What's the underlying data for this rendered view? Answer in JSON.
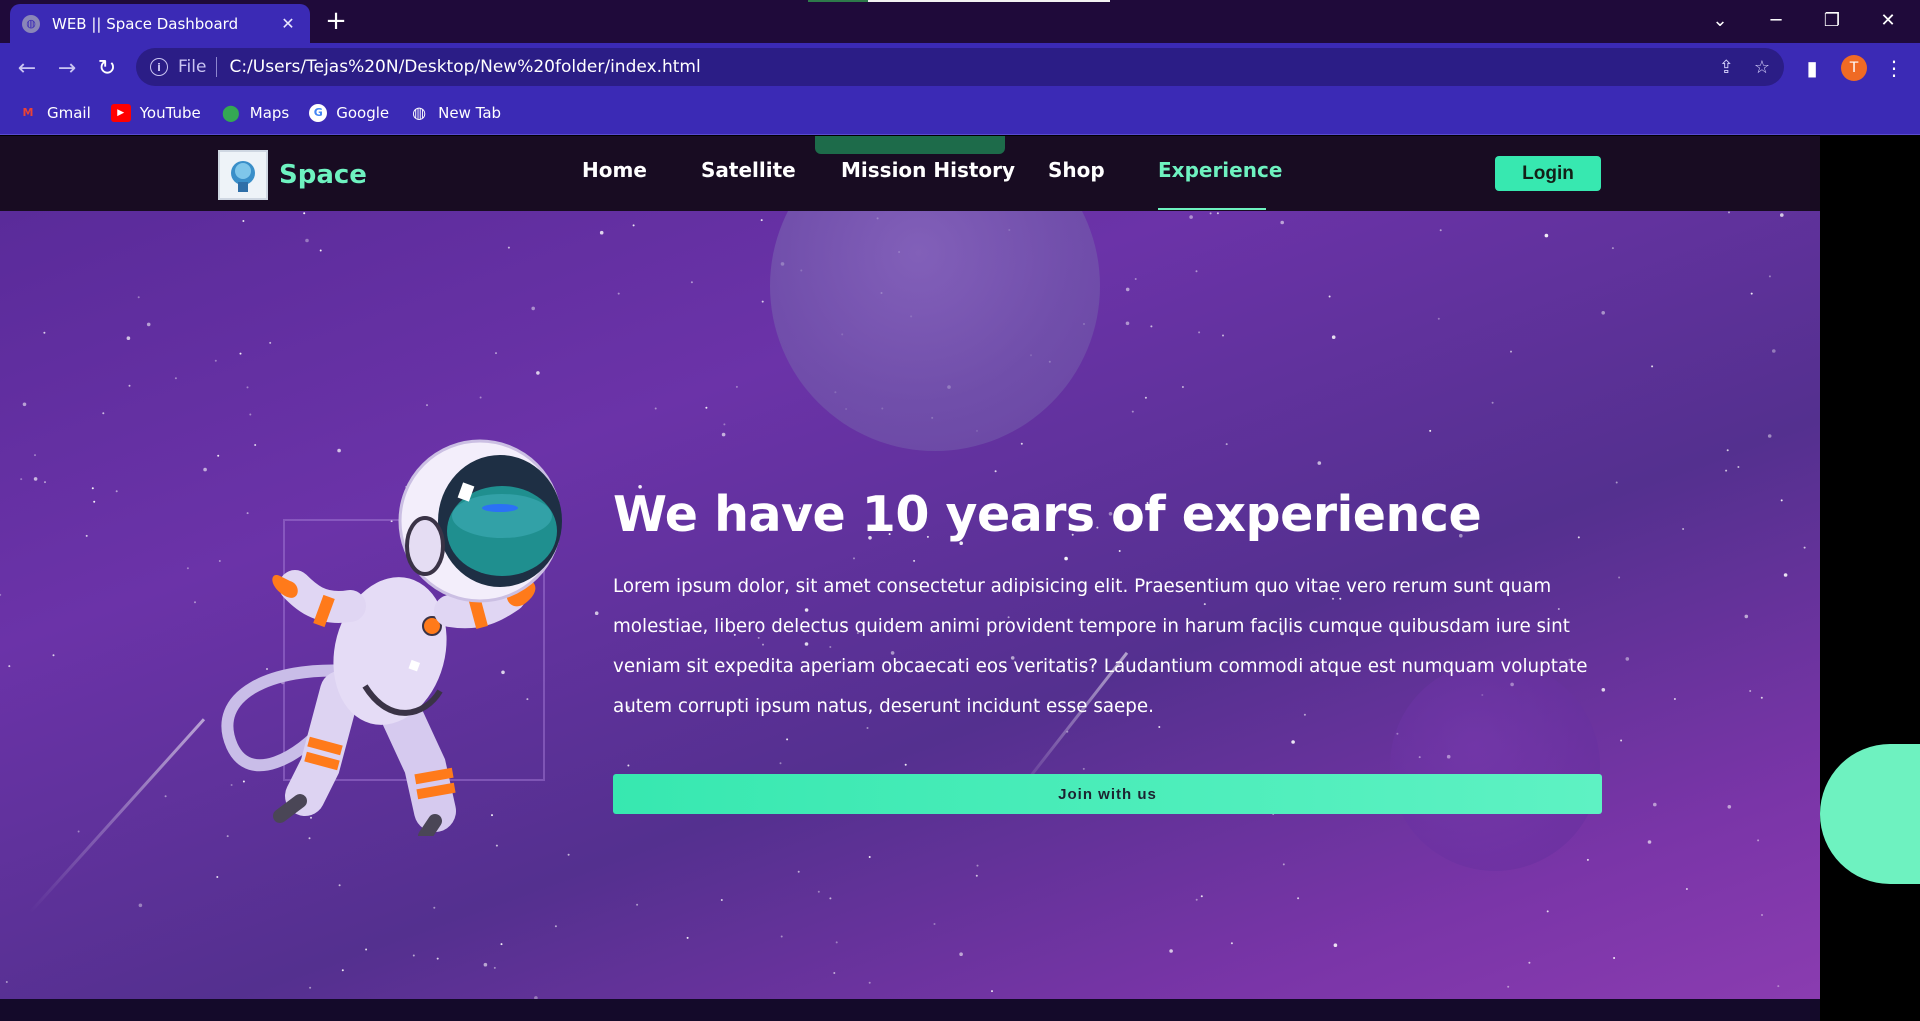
{
  "browser": {
    "tab_title": "WEB || Space Dashboard",
    "address_scheme": "File",
    "address_url": "C:/Users/Tejas%20N/Desktop/New%20folder/index.html",
    "profile_initial": "T",
    "bookmarks": [
      {
        "label": "Gmail",
        "icon": "gmail-icon"
      },
      {
        "label": "YouTube",
        "icon": "youtube-icon"
      },
      {
        "label": "Maps",
        "icon": "maps-icon"
      },
      {
        "label": "Google",
        "icon": "google-icon"
      },
      {
        "label": "New Tab",
        "icon": "globe-icon"
      }
    ]
  },
  "site": {
    "brand": "Space",
    "nav": [
      "Home",
      "Satellite",
      "Mission History",
      "Shop",
      "Experience"
    ],
    "active_nav": "Experience",
    "login_label": "Login",
    "headline": "We have 10 years of experience",
    "paragraph": "Lorem ipsum dolor, sit amet consectetur adipisicing elit. Praesentium quo vitae vero rerum sunt quam molestiae, libero delectus quidem animi provident tempore in harum facilis cumque quibusdam iure sint veniam sit expedita aperiam obcaecati eos veritatis? Laudantium commodi atque est numquam voluptate autem corrupti ipsum natus, deserunt incidunt esse saepe.",
    "cta_label": "Join with us"
  },
  "colors": {
    "browser_accent": "#3b2ab5",
    "brand_accent": "#6ef2c0",
    "button": "#37e8b0",
    "nav_bg": "#180c22",
    "hero_purple": "#6b33a8"
  }
}
